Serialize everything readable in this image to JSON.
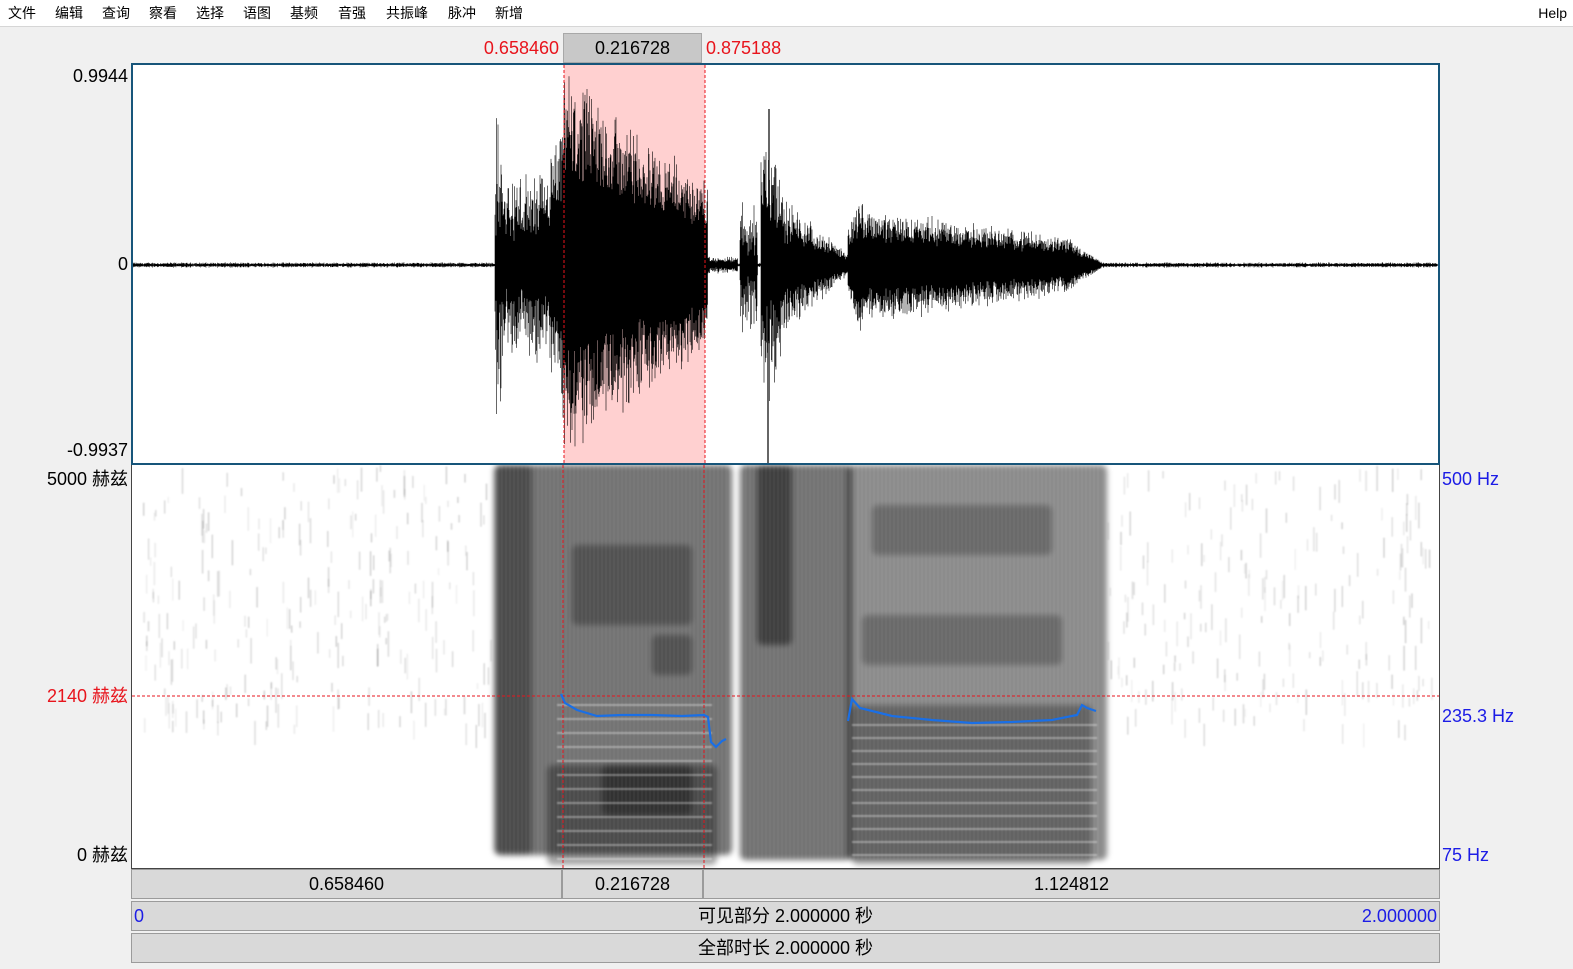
{
  "menu": {
    "items": [
      "文件",
      "编辑",
      "查询",
      "察看",
      "选择",
      "语图",
      "基频",
      "音强",
      "共振峰",
      "脉冲",
      "新增"
    ],
    "help": "Help"
  },
  "selection": {
    "start": "0.658460",
    "duration": "0.216728",
    "end": "0.875188"
  },
  "waveform": {
    "max_label": "0.9944",
    "zero_label": "0",
    "min_label": "-0.9937"
  },
  "spectrogram": {
    "top_freq": "5000 赫兹",
    "cursor_freq": "2140 赫兹",
    "bottom_freq": "0 赫兹",
    "pitch_top": "500 Hz",
    "pitch_cursor": "235.3 Hz",
    "pitch_bottom": "75 Hz"
  },
  "timebar": {
    "left": "0.658460",
    "sel": "0.216728",
    "right": "1.124812"
  },
  "visible": {
    "start": "0",
    "label": "可见部分 2.000000 秒",
    "end": "2.000000"
  },
  "total": {
    "label": "全部时长 2.000000 秒"
  },
  "colors": {
    "accent_red": "#e8141c",
    "pitch_blue": "#1a6fe6",
    "selection_fill": "#ffd0d0",
    "frame_blue": "#17557a"
  }
}
